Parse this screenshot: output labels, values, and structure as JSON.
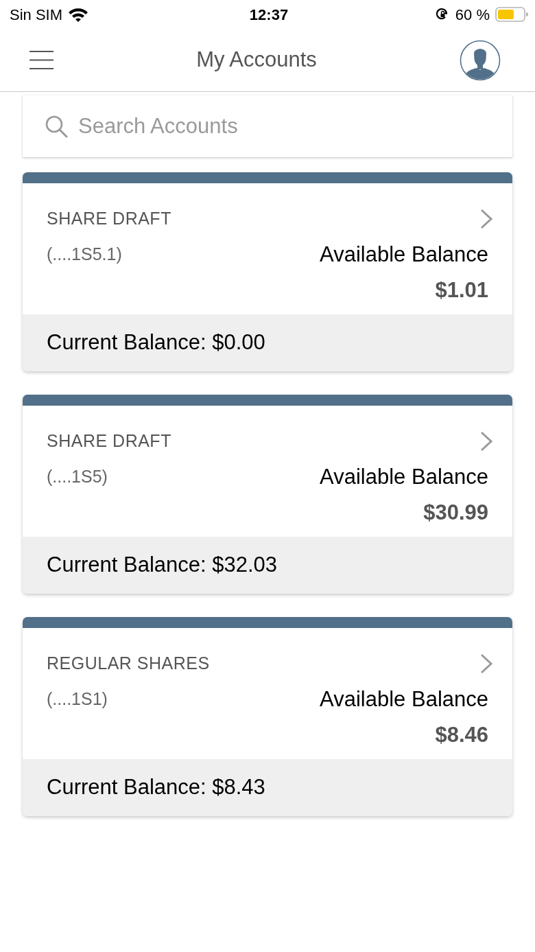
{
  "status_bar": {
    "carrier": "Sin SIM",
    "time": "12:37",
    "battery": "60 %"
  },
  "header": {
    "title": "My Accounts"
  },
  "search": {
    "placeholder": "Search Accounts"
  },
  "accounts": [
    {
      "type": "SHARE DRAFT",
      "number": "(....1S5.1)",
      "available_label": "Available Balance",
      "available": "$1.01",
      "current": "Current Balance: $0.00"
    },
    {
      "type": "SHARE DRAFT",
      "number": "(....1S5)",
      "available_label": "Available Balance",
      "available": "$30.99",
      "current": "Current Balance: $32.03"
    },
    {
      "type": "REGULAR SHARES",
      "number": "(....1S1)",
      "available_label": "Available Balance",
      "available": "$8.46",
      "current": "Current Balance: $8.43"
    }
  ]
}
